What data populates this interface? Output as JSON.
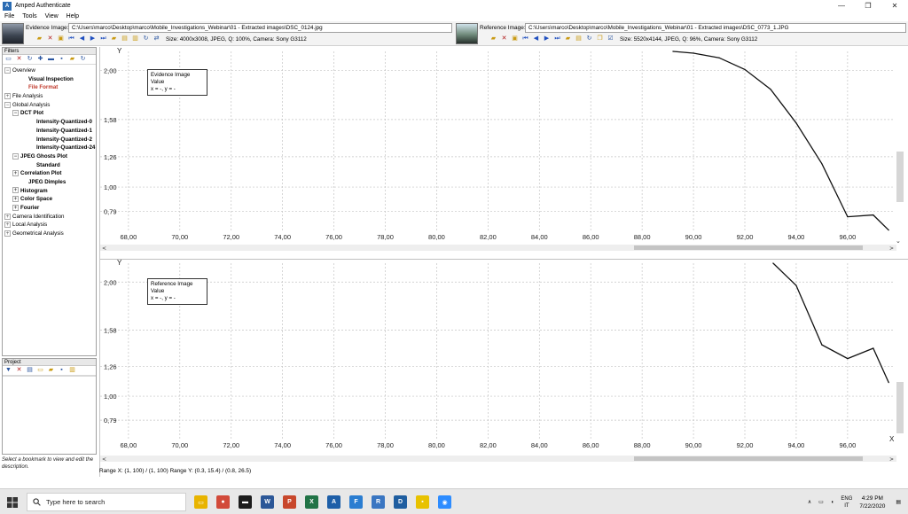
{
  "window": {
    "title": "Amped Authenticate",
    "app_icon": "A",
    "minimize": "—",
    "maximize": "❐",
    "close": "✕"
  },
  "menu": [
    "File",
    "Tools",
    "View",
    "Help"
  ],
  "evidence": {
    "label": "Evidence Image:",
    "path": "C:\\Users\\marco\\Desktop\\marco\\Mobile_Investigations_Webinar\\01 - Extracted images\\DSC_0124.jpg",
    "info": "Size: 4000x3008, JPEG, Q: 100%, Camera: Sony G3112"
  },
  "reference": {
    "label": "Reference Image:",
    "path": "C:\\Users\\marco\\Desktop\\marco\\Mobile_Investigations_Webinar\\01 - Extracted images\\DSC_0773_1.JPG",
    "info": "Size: 5520x4144, JPEG, Q: 96%, Camera: Sony G3112"
  },
  "filters": {
    "title": "Filters",
    "tree": [
      {
        "label": "Overview",
        "level": 0,
        "expander": "−",
        "style": "normal"
      },
      {
        "label": "Visual Inspection",
        "level": 2,
        "expander": "",
        "style": "bold"
      },
      {
        "label": "File Format",
        "level": 2,
        "expander": "",
        "style": "red"
      },
      {
        "label": "File Analysis",
        "level": 0,
        "expander": "+",
        "style": "normal"
      },
      {
        "label": "Global Analysis",
        "level": 0,
        "expander": "−",
        "style": "normal"
      },
      {
        "label": "DCT Plot",
        "level": 1,
        "expander": "−",
        "style": "bold"
      },
      {
        "label": "Intensity-Quantized-0",
        "level": 3,
        "expander": "",
        "style": "bold"
      },
      {
        "label": "Intensity-Quantized-1",
        "level": 3,
        "expander": "",
        "style": "bold"
      },
      {
        "label": "Intensity-Quantized-2",
        "level": 3,
        "expander": "",
        "style": "bold"
      },
      {
        "label": "Intensity-Quantized-24",
        "level": 3,
        "expander": "",
        "style": "bold"
      },
      {
        "label": "JPEG Ghosts Plot",
        "level": 1,
        "expander": "−",
        "style": "bold"
      },
      {
        "label": "Standard",
        "level": 3,
        "expander": "",
        "style": "bold"
      },
      {
        "label": "Correlation Plot",
        "level": 1,
        "expander": "+",
        "style": "bold"
      },
      {
        "label": "JPEG Dimples",
        "level": 2,
        "expander": "",
        "style": "bold"
      },
      {
        "label": "Histogram",
        "level": 1,
        "expander": "+",
        "style": "bold"
      },
      {
        "label": "Color Space",
        "level": 1,
        "expander": "+",
        "style": "bold"
      },
      {
        "label": "Fourier",
        "level": 1,
        "expander": "+",
        "style": "bold"
      },
      {
        "label": "Camera Identification",
        "level": 0,
        "expander": "+",
        "style": "normal"
      },
      {
        "label": "Local Analysis",
        "level": 0,
        "expander": "+",
        "style": "normal"
      },
      {
        "label": "Geometrical Analysis",
        "level": 0,
        "expander": "+",
        "style": "normal"
      }
    ]
  },
  "project": {
    "title": "Project",
    "help": "Select a bookmark to view and edit the description."
  },
  "status": {
    "range": "Range X: (1, 100) / (1, 100) Range Y: (0.3, 15.4) / (0.8, 26.5)"
  },
  "chart_data": [
    {
      "type": "line",
      "title": "Evidence Image Value",
      "readout": "x = -, y = -",
      "ylabel": "Y",
      "xlabel": "",
      "xlim": [
        66.9,
        97.8
      ],
      "ylim": [
        0.62,
        2.165
      ],
      "x_ticks": [
        "68,00",
        "70,00",
        "72,00",
        "74,00",
        "76,00",
        "78,00",
        "80,00",
        "82,00",
        "84,00",
        "86,00",
        "88,00",
        "90,00",
        "92,00",
        "94,00",
        "96,00"
      ],
      "y_ticks": [
        "2,00",
        "1,58",
        "1,26",
        "1,00",
        "0,79"
      ],
      "y_tick_values": [
        2.0,
        1.58,
        1.26,
        1.0,
        0.79
      ],
      "grid": true,
      "series": [
        {
          "values": [
            [
              89.2,
              2.165
            ],
            [
              90,
              2.15
            ],
            [
              91,
              2.11
            ],
            [
              92,
              2.01
            ],
            [
              93,
              1.84
            ],
            [
              94,
              1.55
            ],
            [
              95,
              1.2
            ],
            [
              96,
              0.745
            ],
            [
              97,
              0.76
            ],
            [
              97.6,
              0.63
            ]
          ]
        }
      ]
    },
    {
      "type": "line",
      "title": "Reference Image Value",
      "readout": "x = -, y = -",
      "ylabel": "Y",
      "xlabel": "X",
      "xlim": [
        66.9,
        97.8
      ],
      "ylim": [
        0.62,
        2.165
      ],
      "x_ticks": [
        "68,00",
        "70,00",
        "72,00",
        "74,00",
        "76,00",
        "78,00",
        "80,00",
        "82,00",
        "84,00",
        "86,00",
        "88,00",
        "90,00",
        "92,00",
        "94,00",
        "96,00"
      ],
      "y_ticks": [
        "2,00",
        "1,58",
        "1,26",
        "1,00",
        "0,79"
      ],
      "y_tick_values": [
        2.0,
        1.58,
        1.26,
        1.0,
        0.79
      ],
      "grid": true,
      "series": [
        {
          "values": [
            [
              93.1,
              2.165
            ],
            [
              94,
              1.97
            ],
            [
              95,
              1.45
            ],
            [
              96,
              1.33
            ],
            [
              97,
              1.42
            ],
            [
              97.6,
              1.12
            ]
          ]
        }
      ]
    }
  ],
  "taskbar": {
    "search_placeholder": "Type here to search",
    "apps": [
      {
        "name": "file-explorer",
        "glyph": "▭",
        "color": "#e8b400"
      },
      {
        "name": "chrome",
        "glyph": "●",
        "color": "#d24a3a"
      },
      {
        "name": "terminal",
        "glyph": "▬",
        "color": "#1c1c1c"
      },
      {
        "name": "word",
        "glyph": "W",
        "color": "#2b5797"
      },
      {
        "name": "powerpoint",
        "glyph": "P",
        "color": "#c8472b"
      },
      {
        "name": "excel",
        "glyph": "X",
        "color": "#217346"
      },
      {
        "name": "amped-authenticate",
        "glyph": "A",
        "color": "#1e5fa8"
      },
      {
        "name": "amped-five",
        "glyph": "F",
        "color": "#2a7dd1"
      },
      {
        "name": "amped-replay",
        "glyph": "R",
        "color": "#3a76c2"
      },
      {
        "name": "amped-dve",
        "glyph": "D",
        "color": "#1f5ea0"
      },
      {
        "name": "sticky-notes",
        "glyph": "▪",
        "color": "#e8c200"
      },
      {
        "name": "zoom",
        "glyph": "◉",
        "color": "#2d8cff"
      }
    ],
    "language": "ENG",
    "region": "IT",
    "time": "4:29 PM",
    "date": "7/22/2020"
  }
}
